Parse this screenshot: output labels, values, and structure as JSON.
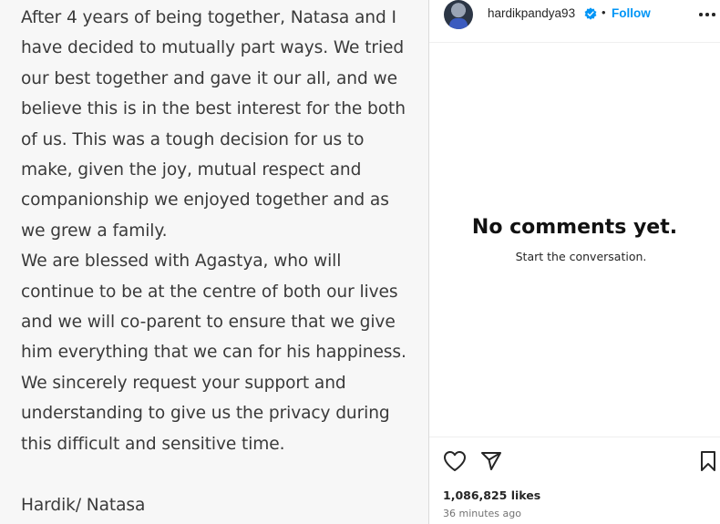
{
  "statement": {
    "lines": [
      "After 4 years of being together, Natasa and I",
      "have decided to mutually part ways. We tried",
      "our best together and gave it our all, and we",
      "believe this is in the best interest for the both",
      "of us. This was a tough decision for us to",
      "make, given the joy, mutual respect and",
      "companionship we enjoyed together and as",
      "we grew a family.",
      "We are blessed with Agastya, who will",
      "continue to be at the centre of both our lives",
      "and we will co-parent to ensure that we give",
      "him everything that we can for his happiness.",
      "We sincerely request your support and",
      "understanding to give us the privacy during",
      "this difficult and sensitive time."
    ],
    "signature": "Hardik/ Natasa"
  },
  "header": {
    "username": "hardikpandya93",
    "separator": "•",
    "follow_label": "Follow",
    "avatar_icon": "profile-avatar",
    "verified_icon": "verified-badge-icon",
    "more_icon": "more-options-icon"
  },
  "comments": {
    "empty_title": "No comments yet.",
    "empty_subtitle": "Start the conversation."
  },
  "actions": {
    "like_icon": "heart-icon",
    "share_icon": "paper-plane-icon",
    "save_icon": "bookmark-icon"
  },
  "post": {
    "likes": "1,086,825 likes",
    "time_ago": "36 minutes ago"
  },
  "colors": {
    "accent": "#0095f6",
    "verified": "#0095f6",
    "text": "#262626",
    "muted": "#737373",
    "panel_bg": "#f7f7f7"
  }
}
